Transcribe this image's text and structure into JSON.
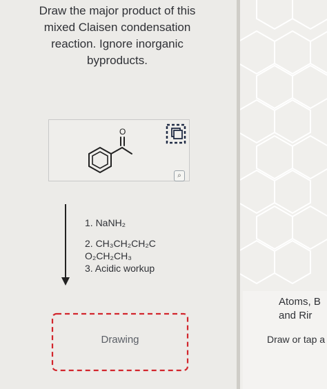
{
  "question": {
    "lines": [
      "Draw the major product of this",
      "mixed Claisen condensation",
      "reaction. Ignore inorganic",
      "byproducts."
    ]
  },
  "reactant": {
    "oxygen_label": "O"
  },
  "conditions": {
    "step1": "1. NaNH₂",
    "step2_line1": "2. CH₃CH₂CH₂C",
    "step2_line2": "O₂CH₂CH₃",
    "step3": "3. Acidic workup"
  },
  "drawing_area": {
    "label": "Drawing"
  },
  "side_panel": {
    "title_line1": "Atoms, B",
    "title_line2": "and Rir",
    "hint": "Draw or tap a"
  },
  "icons": {
    "copy": "copy-structure-icon",
    "zoom": "zoom-icon",
    "arrow": "reaction-arrow-icon"
  },
  "colors": {
    "background": "#ecebe8",
    "drawing_border": "#d2252c",
    "text": "#2f3136"
  }
}
